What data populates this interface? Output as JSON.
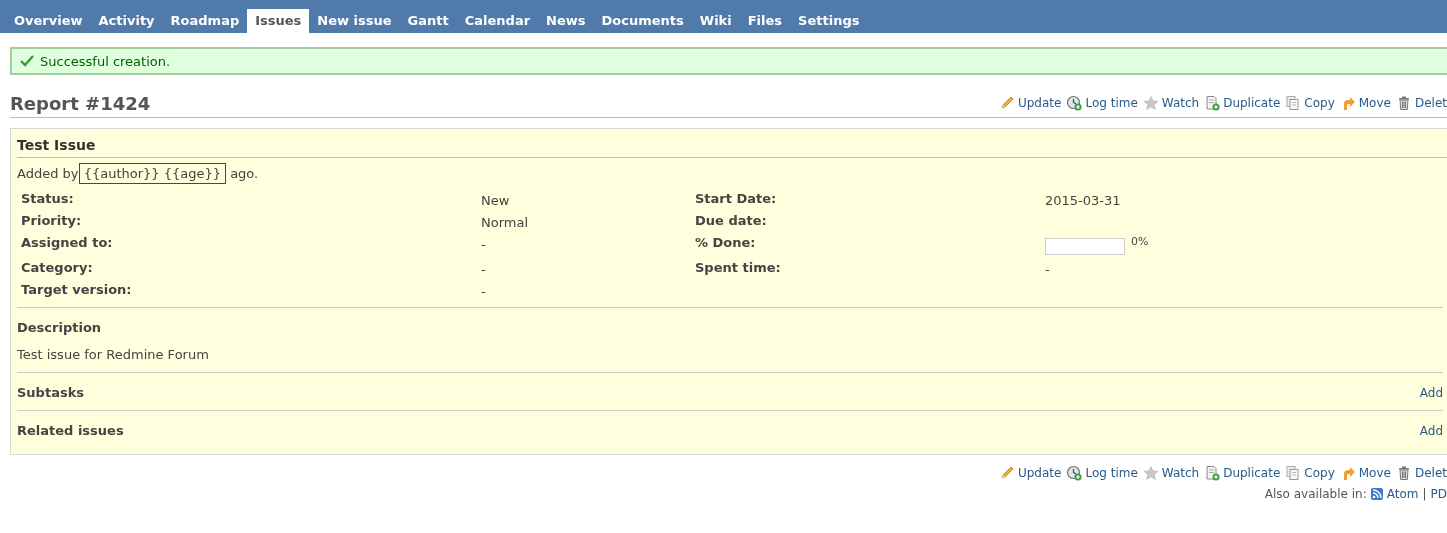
{
  "tabs": [
    {
      "label": "Overview",
      "selected": false
    },
    {
      "label": "Activity",
      "selected": false
    },
    {
      "label": "Roadmap",
      "selected": false
    },
    {
      "label": "Issues",
      "selected": true
    },
    {
      "label": "New issue",
      "selected": false
    },
    {
      "label": "Gantt",
      "selected": false
    },
    {
      "label": "Calendar",
      "selected": false
    },
    {
      "label": "News",
      "selected": false
    },
    {
      "label": "Documents",
      "selected": false
    },
    {
      "label": "Wiki",
      "selected": false
    },
    {
      "label": "Files",
      "selected": false
    },
    {
      "label": "Settings",
      "selected": false
    }
  ],
  "flash": {
    "message": "Successful creation."
  },
  "title": "Report #1424",
  "actions_top": [
    {
      "kind": "pencil",
      "label": "Update"
    },
    {
      "kind": "clock",
      "label": "Log time"
    },
    {
      "kind": "star",
      "label": "Watch"
    },
    {
      "kind": "docplus",
      "label": "Duplicate"
    },
    {
      "kind": "copy",
      "label": "Copy"
    },
    {
      "kind": "arrow",
      "label": "Move"
    },
    {
      "kind": "trash",
      "label": "Delet"
    }
  ],
  "issue": {
    "subject": "Test Issue",
    "added_by": {
      "before": "Added by",
      "highlighted": "{{author}} {{age}}",
      "after": "ago."
    },
    "attributes_left": [
      {
        "label": "Status:",
        "value": "New"
      },
      {
        "label": "Priority:",
        "value": "Normal"
      },
      {
        "label": "Assigned to:",
        "value": "-"
      },
      {
        "label": "Category:",
        "value": "-"
      },
      {
        "label": "Target version:",
        "value": "-"
      }
    ],
    "attributes_right": [
      {
        "label": "Start Date:",
        "kind": "text",
        "value": "2015-03-31"
      },
      {
        "label": "Due date:",
        "kind": "text"
      },
      {
        "label": "% Done:",
        "kind": "progress",
        "level": 0,
        "reading": "0%"
      },
      {
        "label": "Spent time:",
        "kind": "text",
        "value": "-"
      }
    ],
    "description": {
      "heading": "Description",
      "text": "Test issue for Redmine Forum"
    },
    "sections": [
      {
        "heading": "Subtasks",
        "link": "Add"
      },
      {
        "heading": "Related issues",
        "link": "Add"
      }
    ]
  },
  "actions_bottom": [
    {
      "kind": "pencil",
      "label": "Update"
    },
    {
      "kind": "clock",
      "label": "Log time"
    },
    {
      "kind": "star",
      "label": "Watch"
    },
    {
      "kind": "docplus",
      "label": "Duplicate"
    },
    {
      "kind": "copy",
      "label": "Copy"
    },
    {
      "kind": "arrow",
      "label": "Move"
    },
    {
      "kind": "trash",
      "label": "Delet"
    }
  ],
  "other_formats": {
    "label": "Also available in:",
    "links": [
      "Atom",
      "PD"
    ],
    "separator": "|"
  }
}
